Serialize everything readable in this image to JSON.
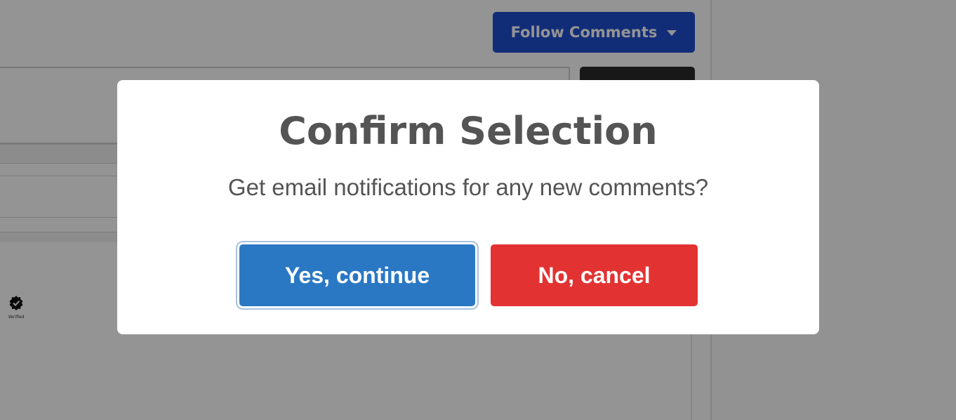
{
  "background": {
    "follow_button": {
      "label": "Follow Comments",
      "icon": "caret-down-icon",
      "color": "#1f4fcf"
    },
    "verified_badge": {
      "label": "Verified",
      "icon": "verified-award-icon"
    }
  },
  "modal": {
    "title": "Confirm Selection",
    "text": "Get email notifications for any new comments?",
    "confirm_button": {
      "label": "Yes, continue",
      "color": "#2a78c4"
    },
    "cancel_button": {
      "label": "No, cancel",
      "color": "#e33232"
    }
  }
}
